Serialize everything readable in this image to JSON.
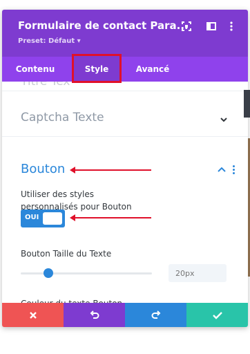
{
  "header": {
    "title": "Formulaire de contact Para...",
    "preset": "Preset: Défaut ▾"
  },
  "tabs": [
    {
      "label": "Contenu"
    },
    {
      "label": "Style"
    },
    {
      "label": "Avancé"
    }
  ],
  "sections": {
    "faded_label": "Titre Tex",
    "captcha_label": "Captcha Texte",
    "bouton_label": "Bouton"
  },
  "fields": {
    "custom_styles_label": "Utiliser des styles personnalisés pour Bouton",
    "toggle_text": "OUI",
    "text_size_label": "Bouton Taille du Texte",
    "text_size_placeholder": "20px",
    "text_size_slider_percent": 22,
    "text_color_label": "Couleur du texte Bouton"
  },
  "colors": {
    "header": "#7e3bd0",
    "tabs_bar": "#8f42ec",
    "accent": "#2b87da",
    "annotation": "#e0102a",
    "footer_discard": "#ef5454",
    "footer_undo": "#7e3bd0",
    "footer_redo": "#2b87da",
    "footer_save": "#29c4a9"
  },
  "icons": [
    "expand-icon",
    "sidebar-toggle-icon",
    "more-icon",
    "chevron-down-icon",
    "chevron-up-icon",
    "close-icon",
    "undo-icon",
    "redo-icon",
    "check-icon"
  ]
}
